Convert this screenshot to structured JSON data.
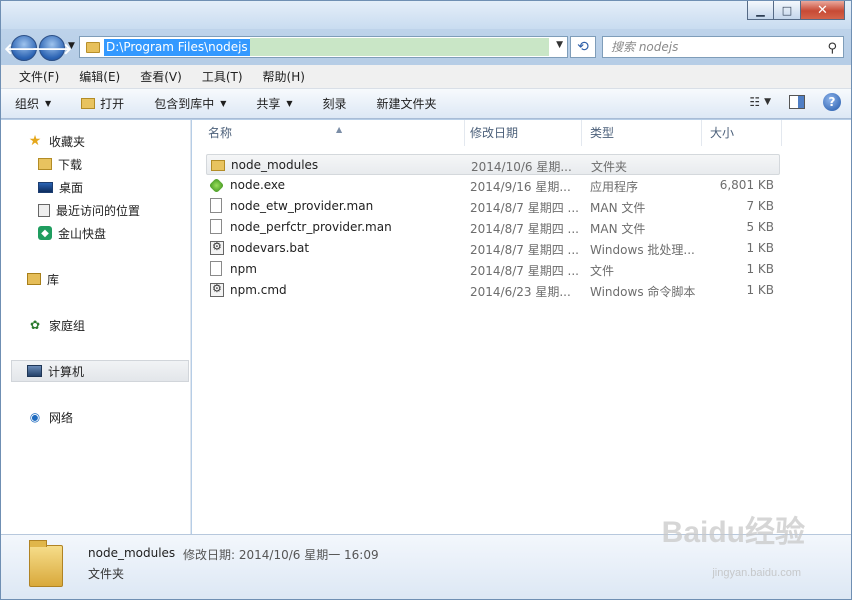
{
  "window": {
    "address": "D:\\Program Files\\nodejs",
    "search_placeholder": "搜索 nodejs",
    "caption": {
      "minimize": "▁",
      "maximize": "□",
      "close": "✕"
    }
  },
  "menubar": [
    "文件(F)",
    "编辑(E)",
    "查看(V)",
    "工具(T)",
    "帮助(H)"
  ],
  "toolbar": {
    "organize": "组织",
    "open": "打开",
    "include_library": "包含到库中",
    "share": "共享",
    "burn": "刻录",
    "new_folder": "新建文件夹"
  },
  "nav": {
    "favorites": "收藏夹",
    "downloads": "下载",
    "desktop": "桌面",
    "recent": "最近访问的位置",
    "kuaipan": "金山快盘",
    "libraries": "库",
    "homegroup": "家庭组",
    "computer": "计算机",
    "network": "网络"
  },
  "columns": {
    "name": "名称",
    "date": "修改日期",
    "type": "类型",
    "size": "大小"
  },
  "files": [
    {
      "name": "node_modules",
      "date": "2014/10/6 星期...",
      "type": "文件夹",
      "size": "",
      "icon": "folder-icon"
    },
    {
      "name": "node.exe",
      "date": "2014/9/16 星期...",
      "type": "应用程序",
      "size": "6,801 KB",
      "icon": "nodejs-exe-icon"
    },
    {
      "name": "node_etw_provider.man",
      "date": "2014/8/7 星期四 ...",
      "type": "MAN 文件",
      "size": "7 KB",
      "icon": "document-icon"
    },
    {
      "name": "node_perfctr_provider.man",
      "date": "2014/8/7 星期四 ...",
      "type": "MAN 文件",
      "size": "5 KB",
      "icon": "document-icon"
    },
    {
      "name": "nodevars.bat",
      "date": "2014/8/7 星期四 ...",
      "type": "Windows 批处理...",
      "size": "1 KB",
      "icon": "batch-file-icon"
    },
    {
      "name": "npm",
      "date": "2014/8/7 星期四 ...",
      "type": "文件",
      "size": "1 KB",
      "icon": "document-icon"
    },
    {
      "name": "npm.cmd",
      "date": "2014/6/23 星期...",
      "type": "Windows 命令脚本",
      "size": "1 KB",
      "icon": "batch-file-icon"
    }
  ],
  "details": {
    "name": "node_modules",
    "meta": "修改日期: 2014/10/6 星期一 16:09",
    "type": "文件夹"
  },
  "watermark": {
    "logo": "Baidu经验",
    "url": "jingyan.baidu.com"
  }
}
